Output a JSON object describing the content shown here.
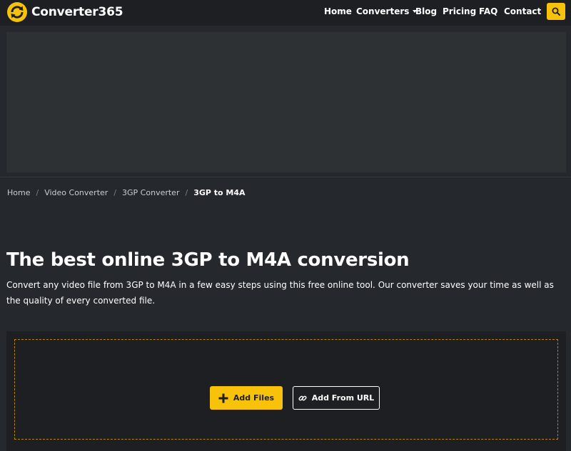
{
  "brand": {
    "name": "Converter365",
    "accent_color": "#f9c20a",
    "logo_icon": "refresh-arrows-icon"
  },
  "nav": {
    "items": [
      {
        "label": "Home"
      },
      {
        "label": "Converters",
        "has_dropdown": true
      },
      {
        "label": "Blog"
      },
      {
        "label": "Pricing"
      },
      {
        "label": "FAQ"
      },
      {
        "label": "Contact"
      }
    ],
    "search_icon": "search-icon"
  },
  "breadcrumb": {
    "items": [
      "Home",
      "Video Converter",
      "3GP Converter"
    ],
    "current": "3GP to M4A"
  },
  "main": {
    "title": "The best online 3GP to M4A conversion",
    "description": "Convert any video file from 3GP to M4A in a few easy steps using this free online tool. Our converter saves your time as well as the quality of every converted file."
  },
  "upload": {
    "add_files_label": "Add Files",
    "add_url_label": "Add From URL"
  }
}
